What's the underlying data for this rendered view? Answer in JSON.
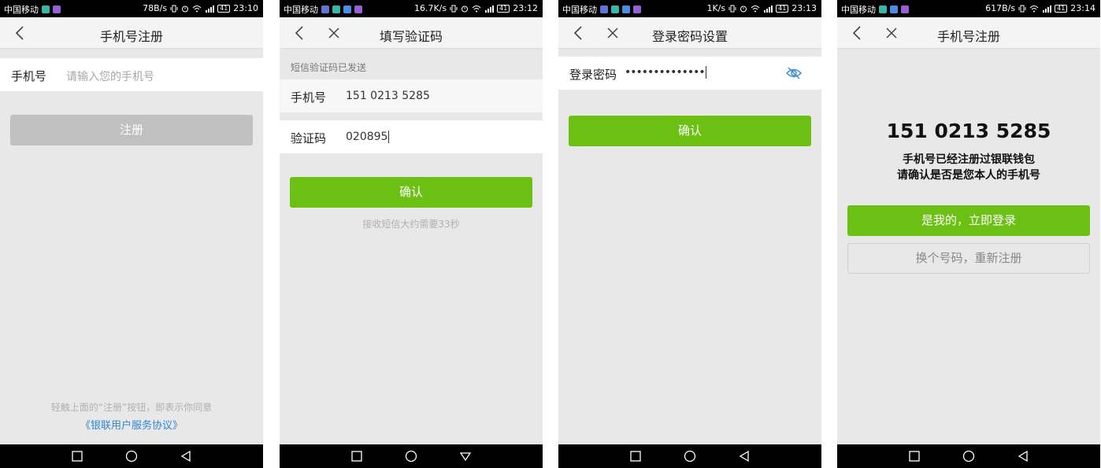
{
  "phones": [
    {
      "status": {
        "carrier": "中国移动",
        "speed": "78B/s",
        "time": "23:10",
        "battery": "41"
      },
      "title": "手机号注册",
      "phone_field": {
        "label": "手机号",
        "placeholder": "请输入您的手机号"
      },
      "register_button": "注册",
      "terms_note": "轻触上面的“注册”按钮，即表示你同意",
      "terms_link": "《银联用户服务协议》"
    },
    {
      "status": {
        "carrier": "中国移动",
        "speed": "16.7K/s",
        "time": "23:12",
        "battery": "41"
      },
      "title": "填写验证码",
      "sms_sent": "短信验证码已发送",
      "phone_field": {
        "label": "手机号",
        "value": "151 0213 5285"
      },
      "code_field": {
        "label": "验证码",
        "value": "020895"
      },
      "confirm_button": "确认",
      "wait_note": "接收短信大约需要33秒"
    },
    {
      "status": {
        "carrier": "中国移动",
        "speed": "1K/s",
        "time": "23:13",
        "battery": "41"
      },
      "title": "登录密码设置",
      "password_field": {
        "label": "登录密码",
        "value": "••••••••••••••"
      },
      "confirm_button": "确认"
    },
    {
      "status": {
        "carrier": "中国移动",
        "speed": "617B/s",
        "time": "23:14",
        "battery": "41"
      },
      "title": "手机号注册",
      "phone_number": "151 0213 5285",
      "message_line1": "手机号已经注册过银联钱包",
      "message_line2": "请确认是否是您本人的手机号",
      "login_button": "是我的，立即登录",
      "reregister_button": "换个号码，重新注册"
    }
  ],
  "colors": {
    "accent_green": "#6cc014",
    "disabled_gray": "#c0c0c0",
    "link_blue": "#2f86d6",
    "background": "#e8e8e8"
  },
  "app_icon_colors": [
    "#5f73d9",
    "#35b8a8",
    "#4a8ee8",
    "#9a5fd6"
  ]
}
